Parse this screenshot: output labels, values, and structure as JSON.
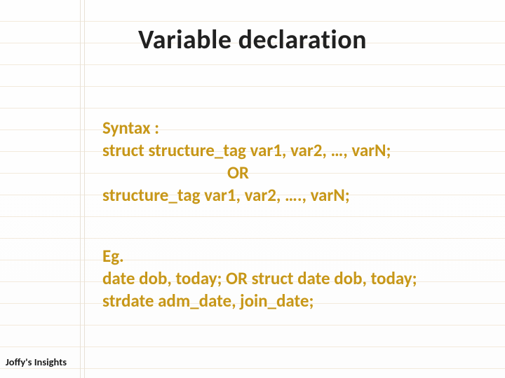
{
  "title": "Variable declaration",
  "syntax": {
    "label": "Syntax :",
    "line1": "struct  structure_tag  var1, var2, …, varN;",
    "or": "OR",
    "line2": "structure_tag  var1, var2, …., varN;"
  },
  "example": {
    "label": "Eg.",
    "line1": "date dob, today;   OR  struct  date dob, today;",
    "line2": "strdate  adm_date, join_date;"
  },
  "footer": "Joffy's Insights"
}
